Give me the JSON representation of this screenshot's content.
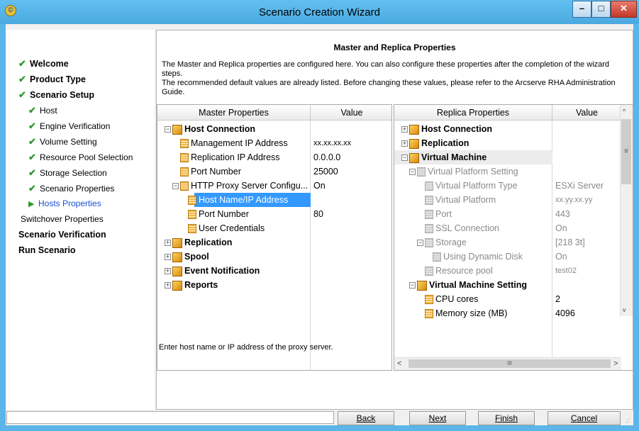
{
  "window": {
    "title": "Scenario Creation Wizard"
  },
  "steps": [
    {
      "label": "Welcome",
      "state": "done",
      "level": "main"
    },
    {
      "label": "Product Type",
      "state": "done",
      "level": "main"
    },
    {
      "label": "Scenario Setup",
      "state": "done",
      "level": "main"
    },
    {
      "label": "Host",
      "state": "done",
      "level": "sub"
    },
    {
      "label": "Engine Verification",
      "state": "done",
      "level": "sub"
    },
    {
      "label": "Volume Setting",
      "state": "done",
      "level": "sub"
    },
    {
      "label": "Resource Pool Selection",
      "state": "done",
      "level": "sub"
    },
    {
      "label": "Storage Selection",
      "state": "done",
      "level": "sub"
    },
    {
      "label": "Scenario Properties",
      "state": "done",
      "level": "sub"
    },
    {
      "label": "Hosts Properties",
      "state": "current",
      "level": "sub"
    },
    {
      "label": "Switchover Properties",
      "state": "pending",
      "level": "sub"
    },
    {
      "label": "Scenario Verification",
      "state": "pending",
      "level": "main"
    },
    {
      "label": "Run Scenario",
      "state": "pending",
      "level": "main"
    }
  ],
  "page": {
    "title": "Master and Replica Properties",
    "description_line1": "The Master and Replica properties are configured here. You can also configure these properties after the completion of the wizard steps.",
    "description_line2": "The recommended default values are already listed. Before changing these values, please refer to the Arcserve RHA Administration Guide."
  },
  "master": {
    "col_property": "Master Properties",
    "col_value": "Value",
    "rows": [
      {
        "label": "Host Connection",
        "value": "",
        "indent": 0,
        "type": "category",
        "expander": "minus"
      },
      {
        "label": "Management IP Address",
        "value": "xx.xx.xx.xx",
        "indent": 2,
        "type": "item",
        "valsize": "small"
      },
      {
        "label": "Replication IP Address",
        "value": "0.0.0.0",
        "indent": 2,
        "type": "item"
      },
      {
        "label": "Port Number",
        "value": "25000",
        "indent": 2,
        "type": "item"
      },
      {
        "label": "HTTP Proxy Server Configu...",
        "value": "On",
        "indent": 1,
        "type": "item",
        "expander": "minus"
      },
      {
        "label": "Host Name/IP Address",
        "value": "",
        "indent": 3,
        "type": "item",
        "selected": true
      },
      {
        "label": "Port Number",
        "value": "80",
        "indent": 3,
        "type": "item"
      },
      {
        "label": "User Credentials",
        "value": "",
        "indent": 3,
        "type": "item"
      },
      {
        "label": "Replication",
        "value": "",
        "indent": 0,
        "type": "category",
        "expander": "plus"
      },
      {
        "label": "Spool",
        "value": "",
        "indent": 0,
        "type": "category",
        "expander": "plus"
      },
      {
        "label": "Event Notification",
        "value": "",
        "indent": 0,
        "type": "category",
        "expander": "plus"
      },
      {
        "label": "Reports",
        "value": "",
        "indent": 0,
        "type": "category",
        "expander": "plus"
      }
    ]
  },
  "replica": {
    "col_property": "Replica Properties",
    "col_value": "Value",
    "rows": [
      {
        "label": "Host Connection",
        "value": "",
        "indent": 0,
        "type": "category",
        "expander": "plus"
      },
      {
        "label": "Replication",
        "value": "",
        "indent": 0,
        "type": "category",
        "expander": "plus"
      },
      {
        "label": "Virtual Machine",
        "value": "",
        "indent": 0,
        "type": "category",
        "expander": "minus",
        "selected_gray": true
      },
      {
        "label": "Virtual Platform Setting",
        "value": "",
        "indent": 1,
        "type": "dim",
        "expander": "minus"
      },
      {
        "label": "Virtual Platform Type",
        "value": "ESXi Server",
        "indent": 3,
        "type": "dim"
      },
      {
        "label": "Virtual Platform",
        "value": "xx.yy.xx.yy",
        "indent": 3,
        "type": "dim",
        "valsize": "small"
      },
      {
        "label": "Port",
        "value": "443",
        "indent": 3,
        "type": "dim"
      },
      {
        "label": "SSL Connection",
        "value": "On",
        "indent": 3,
        "type": "dim"
      },
      {
        "label": "Storage",
        "value": "[218 3t]",
        "indent": 2,
        "type": "dim",
        "expander": "minus"
      },
      {
        "label": "Using Dynamic Disk",
        "value": "On",
        "indent": 4,
        "type": "dim"
      },
      {
        "label": "Resource pool",
        "value": "test02",
        "indent": 3,
        "type": "dim",
        "valsize": "small"
      },
      {
        "label": "Virtual Machine Setting",
        "value": "",
        "indent": 1,
        "type": "category",
        "expander": "minus"
      },
      {
        "label": "CPU cores",
        "value": "2",
        "indent": 3,
        "type": "item"
      },
      {
        "label": "Memory size (MB)",
        "value": "4096",
        "indent": 3,
        "type": "item"
      }
    ]
  },
  "help_text": "Enter host name or IP address of the proxy server.",
  "buttons": {
    "back": "Back",
    "next": "Next",
    "finish": "Finish",
    "cancel": "Cancel"
  },
  "scrollbar": {
    "thumb_glyph": "III",
    "grip_glyph": "≡"
  }
}
